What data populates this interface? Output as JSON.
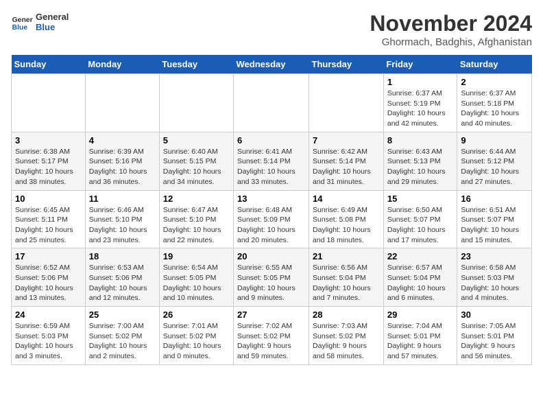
{
  "header": {
    "logo_line1": "General",
    "logo_line2": "Blue",
    "month": "November 2024",
    "location": "Ghormach, Badghis, Afghanistan"
  },
  "weekdays": [
    "Sunday",
    "Monday",
    "Tuesday",
    "Wednesday",
    "Thursday",
    "Friday",
    "Saturday"
  ],
  "weeks": [
    [
      {
        "day": "",
        "detail": ""
      },
      {
        "day": "",
        "detail": ""
      },
      {
        "day": "",
        "detail": ""
      },
      {
        "day": "",
        "detail": ""
      },
      {
        "day": "",
        "detail": ""
      },
      {
        "day": "1",
        "detail": "Sunrise: 6:37 AM\nSunset: 5:19 PM\nDaylight: 10 hours\nand 42 minutes."
      },
      {
        "day": "2",
        "detail": "Sunrise: 6:37 AM\nSunset: 5:18 PM\nDaylight: 10 hours\nand 40 minutes."
      }
    ],
    [
      {
        "day": "3",
        "detail": "Sunrise: 6:38 AM\nSunset: 5:17 PM\nDaylight: 10 hours\nand 38 minutes."
      },
      {
        "day": "4",
        "detail": "Sunrise: 6:39 AM\nSunset: 5:16 PM\nDaylight: 10 hours\nand 36 minutes."
      },
      {
        "day": "5",
        "detail": "Sunrise: 6:40 AM\nSunset: 5:15 PM\nDaylight: 10 hours\nand 34 minutes."
      },
      {
        "day": "6",
        "detail": "Sunrise: 6:41 AM\nSunset: 5:14 PM\nDaylight: 10 hours\nand 33 minutes."
      },
      {
        "day": "7",
        "detail": "Sunrise: 6:42 AM\nSunset: 5:14 PM\nDaylight: 10 hours\nand 31 minutes."
      },
      {
        "day": "8",
        "detail": "Sunrise: 6:43 AM\nSunset: 5:13 PM\nDaylight: 10 hours\nand 29 minutes."
      },
      {
        "day": "9",
        "detail": "Sunrise: 6:44 AM\nSunset: 5:12 PM\nDaylight: 10 hours\nand 27 minutes."
      }
    ],
    [
      {
        "day": "10",
        "detail": "Sunrise: 6:45 AM\nSunset: 5:11 PM\nDaylight: 10 hours\nand 25 minutes."
      },
      {
        "day": "11",
        "detail": "Sunrise: 6:46 AM\nSunset: 5:10 PM\nDaylight: 10 hours\nand 23 minutes."
      },
      {
        "day": "12",
        "detail": "Sunrise: 6:47 AM\nSunset: 5:10 PM\nDaylight: 10 hours\nand 22 minutes."
      },
      {
        "day": "13",
        "detail": "Sunrise: 6:48 AM\nSunset: 5:09 PM\nDaylight: 10 hours\nand 20 minutes."
      },
      {
        "day": "14",
        "detail": "Sunrise: 6:49 AM\nSunset: 5:08 PM\nDaylight: 10 hours\nand 18 minutes."
      },
      {
        "day": "15",
        "detail": "Sunrise: 6:50 AM\nSunset: 5:07 PM\nDaylight: 10 hours\nand 17 minutes."
      },
      {
        "day": "16",
        "detail": "Sunrise: 6:51 AM\nSunset: 5:07 PM\nDaylight: 10 hours\nand 15 minutes."
      }
    ],
    [
      {
        "day": "17",
        "detail": "Sunrise: 6:52 AM\nSunset: 5:06 PM\nDaylight: 10 hours\nand 13 minutes."
      },
      {
        "day": "18",
        "detail": "Sunrise: 6:53 AM\nSunset: 5:06 PM\nDaylight: 10 hours\nand 12 minutes."
      },
      {
        "day": "19",
        "detail": "Sunrise: 6:54 AM\nSunset: 5:05 PM\nDaylight: 10 hours\nand 10 minutes."
      },
      {
        "day": "20",
        "detail": "Sunrise: 6:55 AM\nSunset: 5:05 PM\nDaylight: 10 hours\nand 9 minutes."
      },
      {
        "day": "21",
        "detail": "Sunrise: 6:56 AM\nSunset: 5:04 PM\nDaylight: 10 hours\nand 7 minutes."
      },
      {
        "day": "22",
        "detail": "Sunrise: 6:57 AM\nSunset: 5:04 PM\nDaylight: 10 hours\nand 6 minutes."
      },
      {
        "day": "23",
        "detail": "Sunrise: 6:58 AM\nSunset: 5:03 PM\nDaylight: 10 hours\nand 4 minutes."
      }
    ],
    [
      {
        "day": "24",
        "detail": "Sunrise: 6:59 AM\nSunset: 5:03 PM\nDaylight: 10 hours\nand 3 minutes."
      },
      {
        "day": "25",
        "detail": "Sunrise: 7:00 AM\nSunset: 5:02 PM\nDaylight: 10 hours\nand 2 minutes."
      },
      {
        "day": "26",
        "detail": "Sunrise: 7:01 AM\nSunset: 5:02 PM\nDaylight: 10 hours\nand 0 minutes."
      },
      {
        "day": "27",
        "detail": "Sunrise: 7:02 AM\nSunset: 5:02 PM\nDaylight: 9 hours\nand 59 minutes."
      },
      {
        "day": "28",
        "detail": "Sunrise: 7:03 AM\nSunset: 5:02 PM\nDaylight: 9 hours\nand 58 minutes."
      },
      {
        "day": "29",
        "detail": "Sunrise: 7:04 AM\nSunset: 5:01 PM\nDaylight: 9 hours\nand 57 minutes."
      },
      {
        "day": "30",
        "detail": "Sunrise: 7:05 AM\nSunset: 5:01 PM\nDaylight: 9 hours\nand 56 minutes."
      }
    ]
  ]
}
